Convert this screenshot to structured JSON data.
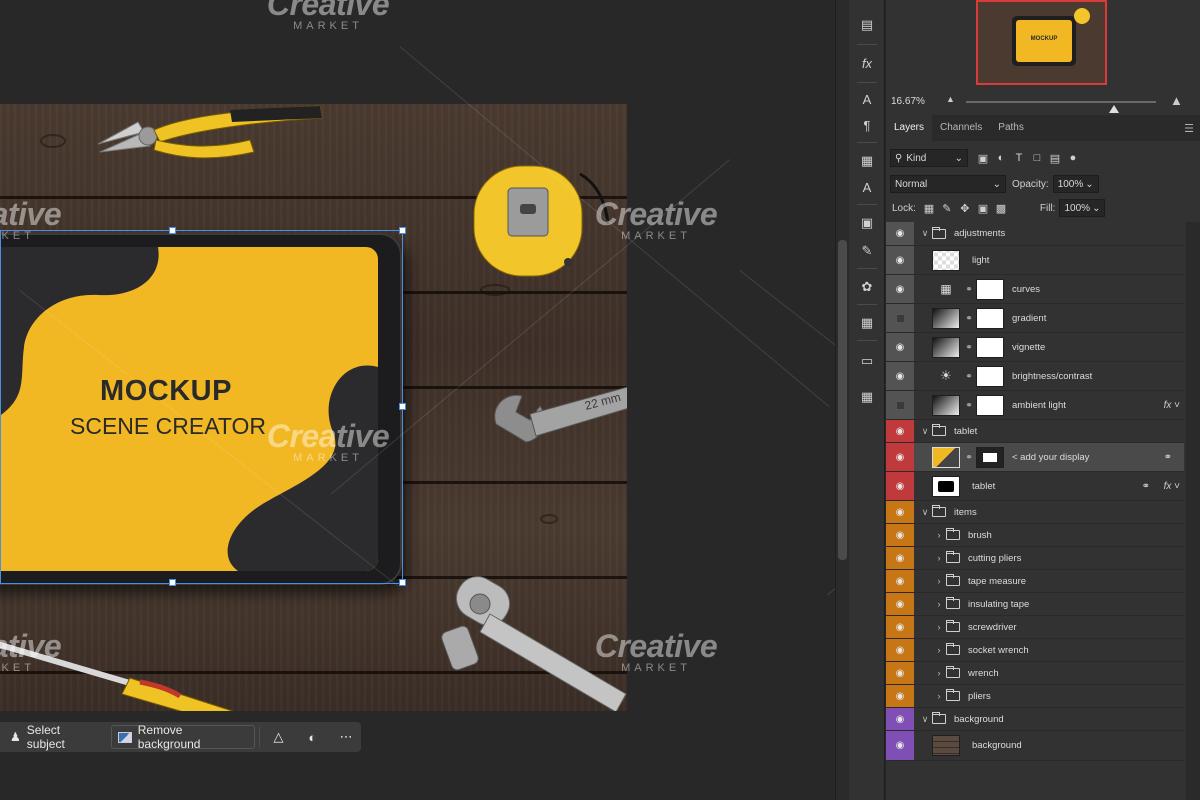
{
  "context_bar": {
    "select_subject": "Select subject",
    "remove_background": "Remove background"
  },
  "mockup": {
    "title": "MOCKUP",
    "subtitle": "SCENE CREATOR",
    "screen_color": "#f2b824",
    "wrench_label": "22 mm"
  },
  "watermark": {
    "brand": "Creative",
    "sub": "MARKET"
  },
  "navigator": {
    "zoom": "16.67%",
    "zoom_fraction": 0.72,
    "thumb_title": "MOCKUP"
  },
  "panel_tabs": [
    "Layers",
    "Channels",
    "Paths"
  ],
  "filter": {
    "kind_label": "Kind"
  },
  "blend": {
    "mode": "Normal",
    "opacity_label": "Opacity:",
    "opacity": "100%",
    "lock_label": "Lock:",
    "fill_label": "Fill:",
    "fill": "100%"
  },
  "layers": [
    {
      "name": "adjustments",
      "type": "group",
      "color": "#535353",
      "visible": true,
      "expanded": true
    },
    {
      "name": "light",
      "type": "pixel",
      "color": "#535353",
      "visible": true
    },
    {
      "name": "curves",
      "type": "adjust",
      "color": "#535353",
      "visible": true,
      "icon": "curves-icon"
    },
    {
      "name": "gradient",
      "type": "adjust",
      "color": "#535353",
      "visible": false,
      "icon": "gradient-icon"
    },
    {
      "name": "vignette",
      "type": "adjust",
      "color": "#535353",
      "visible": true,
      "icon": "gradient-icon"
    },
    {
      "name": "brightness/contrast",
      "type": "adjust",
      "color": "#535353",
      "visible": true,
      "icon": "sun-icon"
    },
    {
      "name": "ambient light",
      "type": "adjust",
      "color": "#535353",
      "visible": false,
      "icon": "gradient-icon",
      "fx": "fx"
    },
    {
      "name": "tablet",
      "type": "group",
      "color": "#c0393b",
      "visible": true,
      "expanded": true
    },
    {
      "name": "< add your display",
      "type": "smart",
      "color": "#c0393b",
      "visible": true,
      "selected": true
    },
    {
      "name": "tablet",
      "type": "shape",
      "color": "#c0393b",
      "visible": true,
      "fx": "fx"
    },
    {
      "name": "items",
      "type": "group",
      "color": "#c67614",
      "visible": true,
      "expanded": true
    },
    {
      "name": "brush",
      "type": "subgroup",
      "color": "#c67614",
      "visible": true
    },
    {
      "name": "cutting pliers",
      "type": "subgroup",
      "color": "#c67614",
      "visible": true
    },
    {
      "name": "tape measure",
      "type": "subgroup",
      "color": "#c67614",
      "visible": true
    },
    {
      "name": "insulating tape",
      "type": "subgroup",
      "color": "#c67614",
      "visible": true
    },
    {
      "name": "screwdriver",
      "type": "subgroup",
      "color": "#c67614",
      "visible": true
    },
    {
      "name": "socket wrench",
      "type": "subgroup",
      "color": "#c67614",
      "visible": true
    },
    {
      "name": "wrench",
      "type": "subgroup",
      "color": "#c67614",
      "visible": true
    },
    {
      "name": "pliers",
      "type": "subgroup",
      "color": "#c67614",
      "visible": true
    },
    {
      "name": "background",
      "type": "group",
      "color": "#7f4fb6",
      "visible": true,
      "expanded": true
    },
    {
      "name": "background",
      "type": "pixel-wood",
      "color": "#7f4fb6",
      "visible": true
    }
  ]
}
